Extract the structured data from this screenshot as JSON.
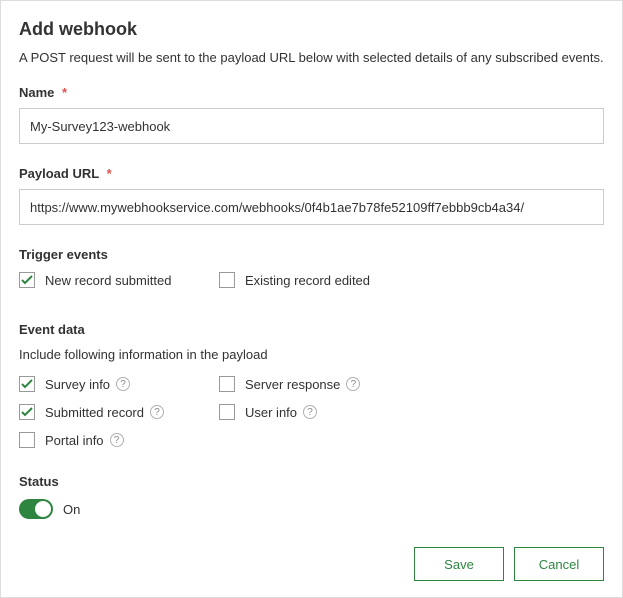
{
  "title": "Add webhook",
  "description": "A POST request will be sent to the payload URL below with selected details of any subscribed events.",
  "name": {
    "label": "Name",
    "value": "My-Survey123-webhook"
  },
  "payload_url": {
    "label": "Payload URL",
    "value": "https://www.mywebhookservice.com/webhooks/0f4b1ae7b78fe52109ff7ebbb9cb4a34/"
  },
  "trigger": {
    "label": "Trigger events",
    "options": {
      "new_record": {
        "label": "New record submitted",
        "checked": true
      },
      "existing_record": {
        "label": "Existing record edited",
        "checked": false
      }
    }
  },
  "event_data": {
    "label": "Event data",
    "subtext": "Include following information in the payload",
    "options": {
      "survey_info": {
        "label": "Survey info",
        "checked": true
      },
      "server_response": {
        "label": "Server response",
        "checked": false
      },
      "submitted_record": {
        "label": "Submitted record",
        "checked": true
      },
      "user_info": {
        "label": "User info",
        "checked": false
      },
      "portal_info": {
        "label": "Portal info",
        "checked": false
      }
    }
  },
  "status": {
    "label": "Status",
    "value": "On"
  },
  "buttons": {
    "save": "Save",
    "cancel": "Cancel"
  },
  "required_mark": "*",
  "help_glyph": "?"
}
